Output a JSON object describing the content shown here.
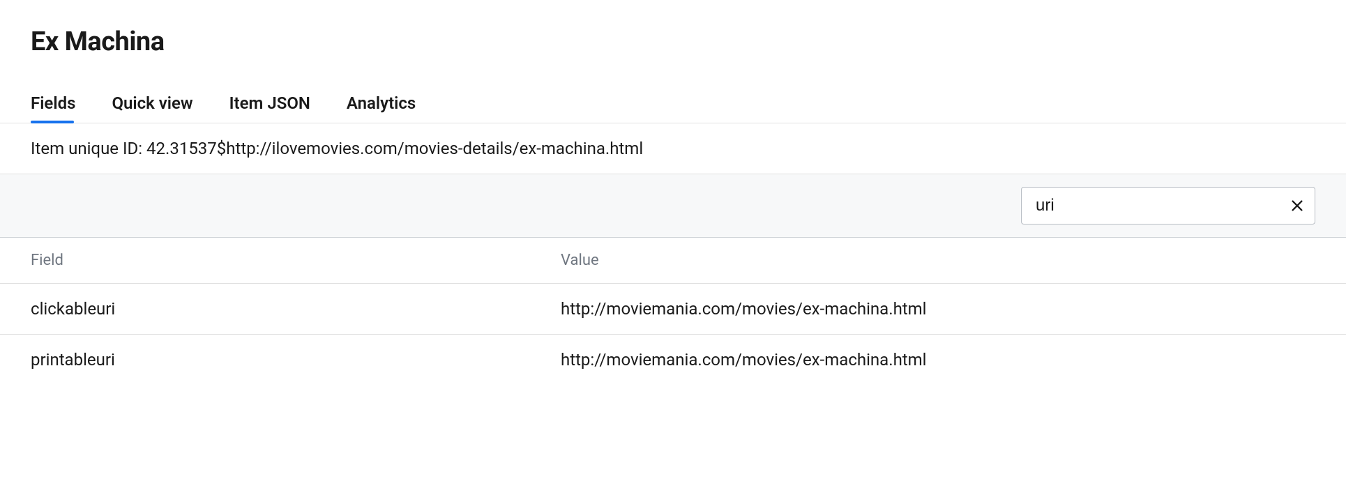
{
  "page": {
    "title": "Ex Machina"
  },
  "tabs": [
    {
      "label": "Fields",
      "active": true
    },
    {
      "label": "Quick view",
      "active": false
    },
    {
      "label": "Item JSON",
      "active": false
    },
    {
      "label": "Analytics",
      "active": false
    }
  ],
  "item_id": {
    "label": "Item unique ID: ",
    "value": "42.31537$http://ilovemovies.com/movies-details/ex-machina.html"
  },
  "search": {
    "value": "uri"
  },
  "table": {
    "headers": {
      "field": "Field",
      "value": "Value"
    },
    "rows": [
      {
        "field": "clickableuri",
        "value": "http://moviemania.com/movies/ex-machina.html"
      },
      {
        "field": "printableuri",
        "value": "http://moviemania.com/movies/ex-machina.html"
      }
    ]
  }
}
